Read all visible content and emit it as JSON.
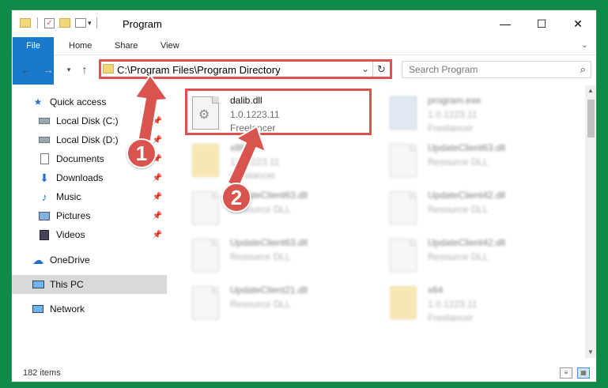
{
  "window": {
    "title": "Program",
    "minimize": "—",
    "maximize": "☐",
    "close": "✕"
  },
  "ribbon": {
    "tabs": [
      "File",
      "Home",
      "Share",
      "View"
    ],
    "expand": "⌄"
  },
  "address": {
    "path": "C:\\Program Files\\Program Directory",
    "search_placeholder": "Search Program"
  },
  "nav": {
    "items": [
      {
        "label": "Quick access",
        "icon": "star-icon"
      },
      {
        "label": "Local Disk (C:)",
        "icon": "drive-icon",
        "pinned": true
      },
      {
        "label": "Local Disk (D:)",
        "icon": "drive-icon",
        "pinned": true
      },
      {
        "label": "Documents",
        "icon": "documents-icon",
        "pinned": true
      },
      {
        "label": "Downloads",
        "icon": "downloads-icon",
        "pinned": true
      },
      {
        "label": "Music",
        "icon": "music-icon",
        "pinned": true
      },
      {
        "label": "Pictures",
        "icon": "pictures-icon",
        "pinned": true
      },
      {
        "label": "Videos",
        "icon": "videos-icon",
        "pinned": true
      },
      {
        "label": "OneDrive",
        "icon": "onedrive-icon"
      },
      {
        "label": "This PC",
        "icon": "pc-icon",
        "selected": true
      },
      {
        "label": "Network",
        "icon": "network-icon"
      }
    ]
  },
  "files": [
    {
      "name": "dalib.dll",
      "version": "1.0.1223.11",
      "desc": "Freelancer",
      "type": "dll",
      "highlighted": true
    },
    {
      "name": "program.exe",
      "version": "1.0.1223.11",
      "desc": "Freelancer",
      "type": "exe"
    },
    {
      "name": "x86",
      "version": "1.0.1223.11",
      "desc": "Freelancer",
      "type": "folder"
    },
    {
      "name": "UpdateClient63.dll",
      "version": "",
      "desc": "Resource DLL",
      "type": "dll"
    },
    {
      "name": "UpdateClient63.dll",
      "version": "",
      "desc": "Resource DLL",
      "type": "dll"
    },
    {
      "name": "UpdateClient42.dll",
      "version": "",
      "desc": "Resource DLL",
      "type": "dll"
    },
    {
      "name": "UpdateClient63.dll",
      "version": "",
      "desc": "Resource DLL",
      "type": "dll"
    },
    {
      "name": "UpdateClient42.dll",
      "version": "",
      "desc": "Resource DLL",
      "type": "dll"
    },
    {
      "name": "UpdateClient21.dll",
      "version": "",
      "desc": "Resource DLL",
      "type": "dll"
    },
    {
      "name": "x64",
      "version": "1.0.1223.11",
      "desc": "Freelancer",
      "type": "folder"
    }
  ],
  "status": {
    "count": "182 items"
  },
  "annotations": {
    "step1": "1",
    "step2": "2",
    "color": "#d9534f"
  }
}
